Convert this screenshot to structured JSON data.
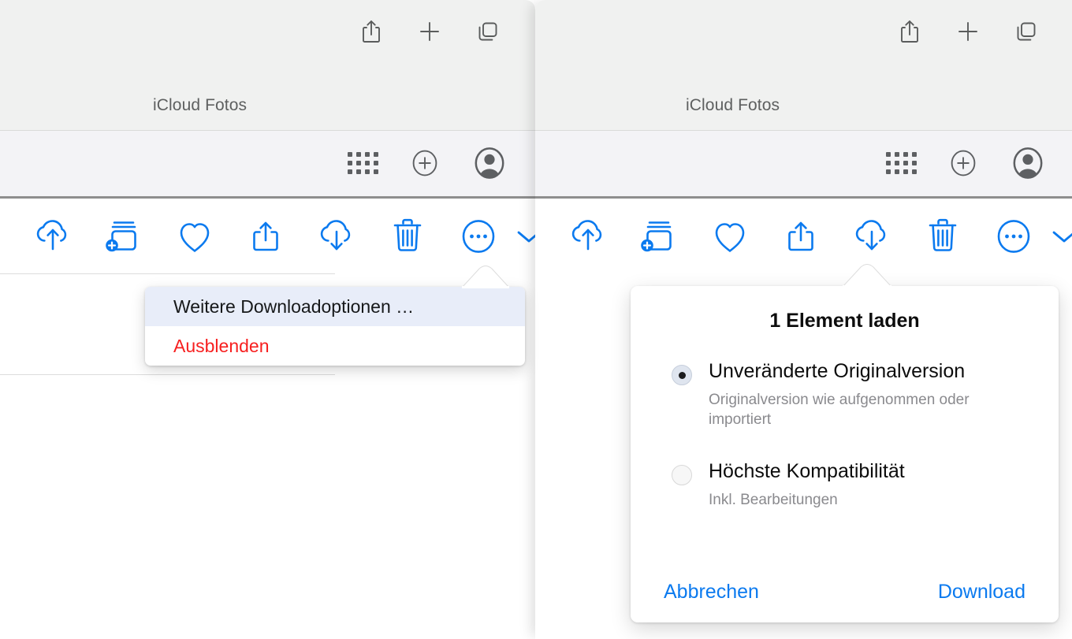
{
  "left_window": {
    "titlebar": {
      "icons": [
        "share-icon",
        "new-tab-icon",
        "tab-overview-icon"
      ],
      "site_title": "iCloud Fotos",
      "apple_glyph": ""
    },
    "subbar": {
      "icons": [
        "app-grid-icon",
        "add-circle-icon",
        "account-avatar-icon"
      ]
    },
    "photo_toolbar": {
      "icons": [
        "cloud-upload-icon",
        "add-to-album-icon",
        "favorite-heart-icon",
        "share-icon",
        "cloud-download-icon",
        "trash-icon",
        "more-ellipsis-icon",
        "chevron-down-icon"
      ]
    },
    "menu": {
      "items": [
        {
          "label": "Weitere Downloadoptionen …",
          "state": "selected",
          "style": "normal"
        },
        {
          "label": "Ausblenden",
          "state": "normal",
          "style": "danger"
        }
      ]
    }
  },
  "right_window": {
    "titlebar": {
      "icons": [
        "share-icon",
        "new-tab-icon",
        "tab-overview-icon"
      ],
      "site_title": "iCloud Fotos",
      "apple_glyph": ""
    },
    "subbar": {
      "icons": [
        "app-grid-icon",
        "add-circle-icon",
        "account-avatar-icon"
      ]
    },
    "photo_toolbar": {
      "icons": [
        "cloud-upload-icon",
        "add-to-album-icon",
        "favorite-heart-icon",
        "share-icon",
        "cloud-download-icon",
        "trash-icon",
        "more-ellipsis-icon",
        "chevron-down-icon"
      ]
    },
    "popover": {
      "title": "1 Element laden",
      "options": [
        {
          "label": "Unveränderte Originalversion",
          "description": "Originalversion wie aufgenommen oder importiert",
          "selected": true
        },
        {
          "label": "Höchste Kompatibilität",
          "description": "Inkl. Bearbeitungen",
          "selected": false
        }
      ],
      "cancel_label": "Abbrechen",
      "confirm_label": "Download"
    }
  },
  "colors": {
    "accent_blue": "#0b7aef",
    "danger_red": "#f71f1f",
    "menu_highlight": "#e8edf9",
    "titlebar_bg": "#f0f1f0",
    "subbar_bg": "#f3f3f6",
    "icon_gray": "#5d5f62",
    "subtext_gray": "#8a8a8e"
  }
}
